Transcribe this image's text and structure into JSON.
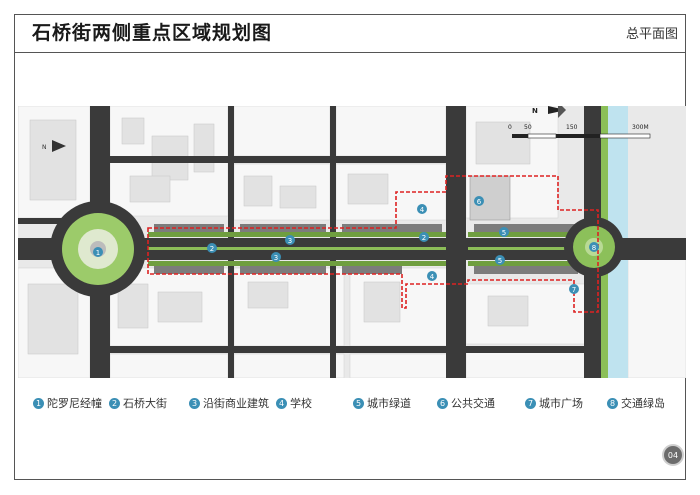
{
  "header": {
    "title": "石桥街两侧重点区域规划图",
    "subtitle": "总平面图"
  },
  "map": {
    "scale_labels": [
      "0",
      "50",
      "150",
      "300M"
    ],
    "north_label": "N",
    "colors": {
      "road": "#3a3a3a",
      "block": "#f4f4f4",
      "green": "#7aa84a",
      "water": "#bfe3ef",
      "boundary": "#d22",
      "marker": "#3b8fb5"
    }
  },
  "legend": {
    "items": [
      {
        "num": "1",
        "label": "陀罗尼经幢"
      },
      {
        "num": "2",
        "label": "石桥大街"
      },
      {
        "num": "3",
        "label": "沿街商业建筑"
      },
      {
        "num": "4",
        "label": "学校"
      },
      {
        "num": "5",
        "label": "城市绿道"
      },
      {
        "num": "6",
        "label": "公共交通"
      },
      {
        "num": "7",
        "label": "城市广场"
      },
      {
        "num": "8",
        "label": "交通绿岛"
      }
    ]
  },
  "page": {
    "number": "04"
  }
}
